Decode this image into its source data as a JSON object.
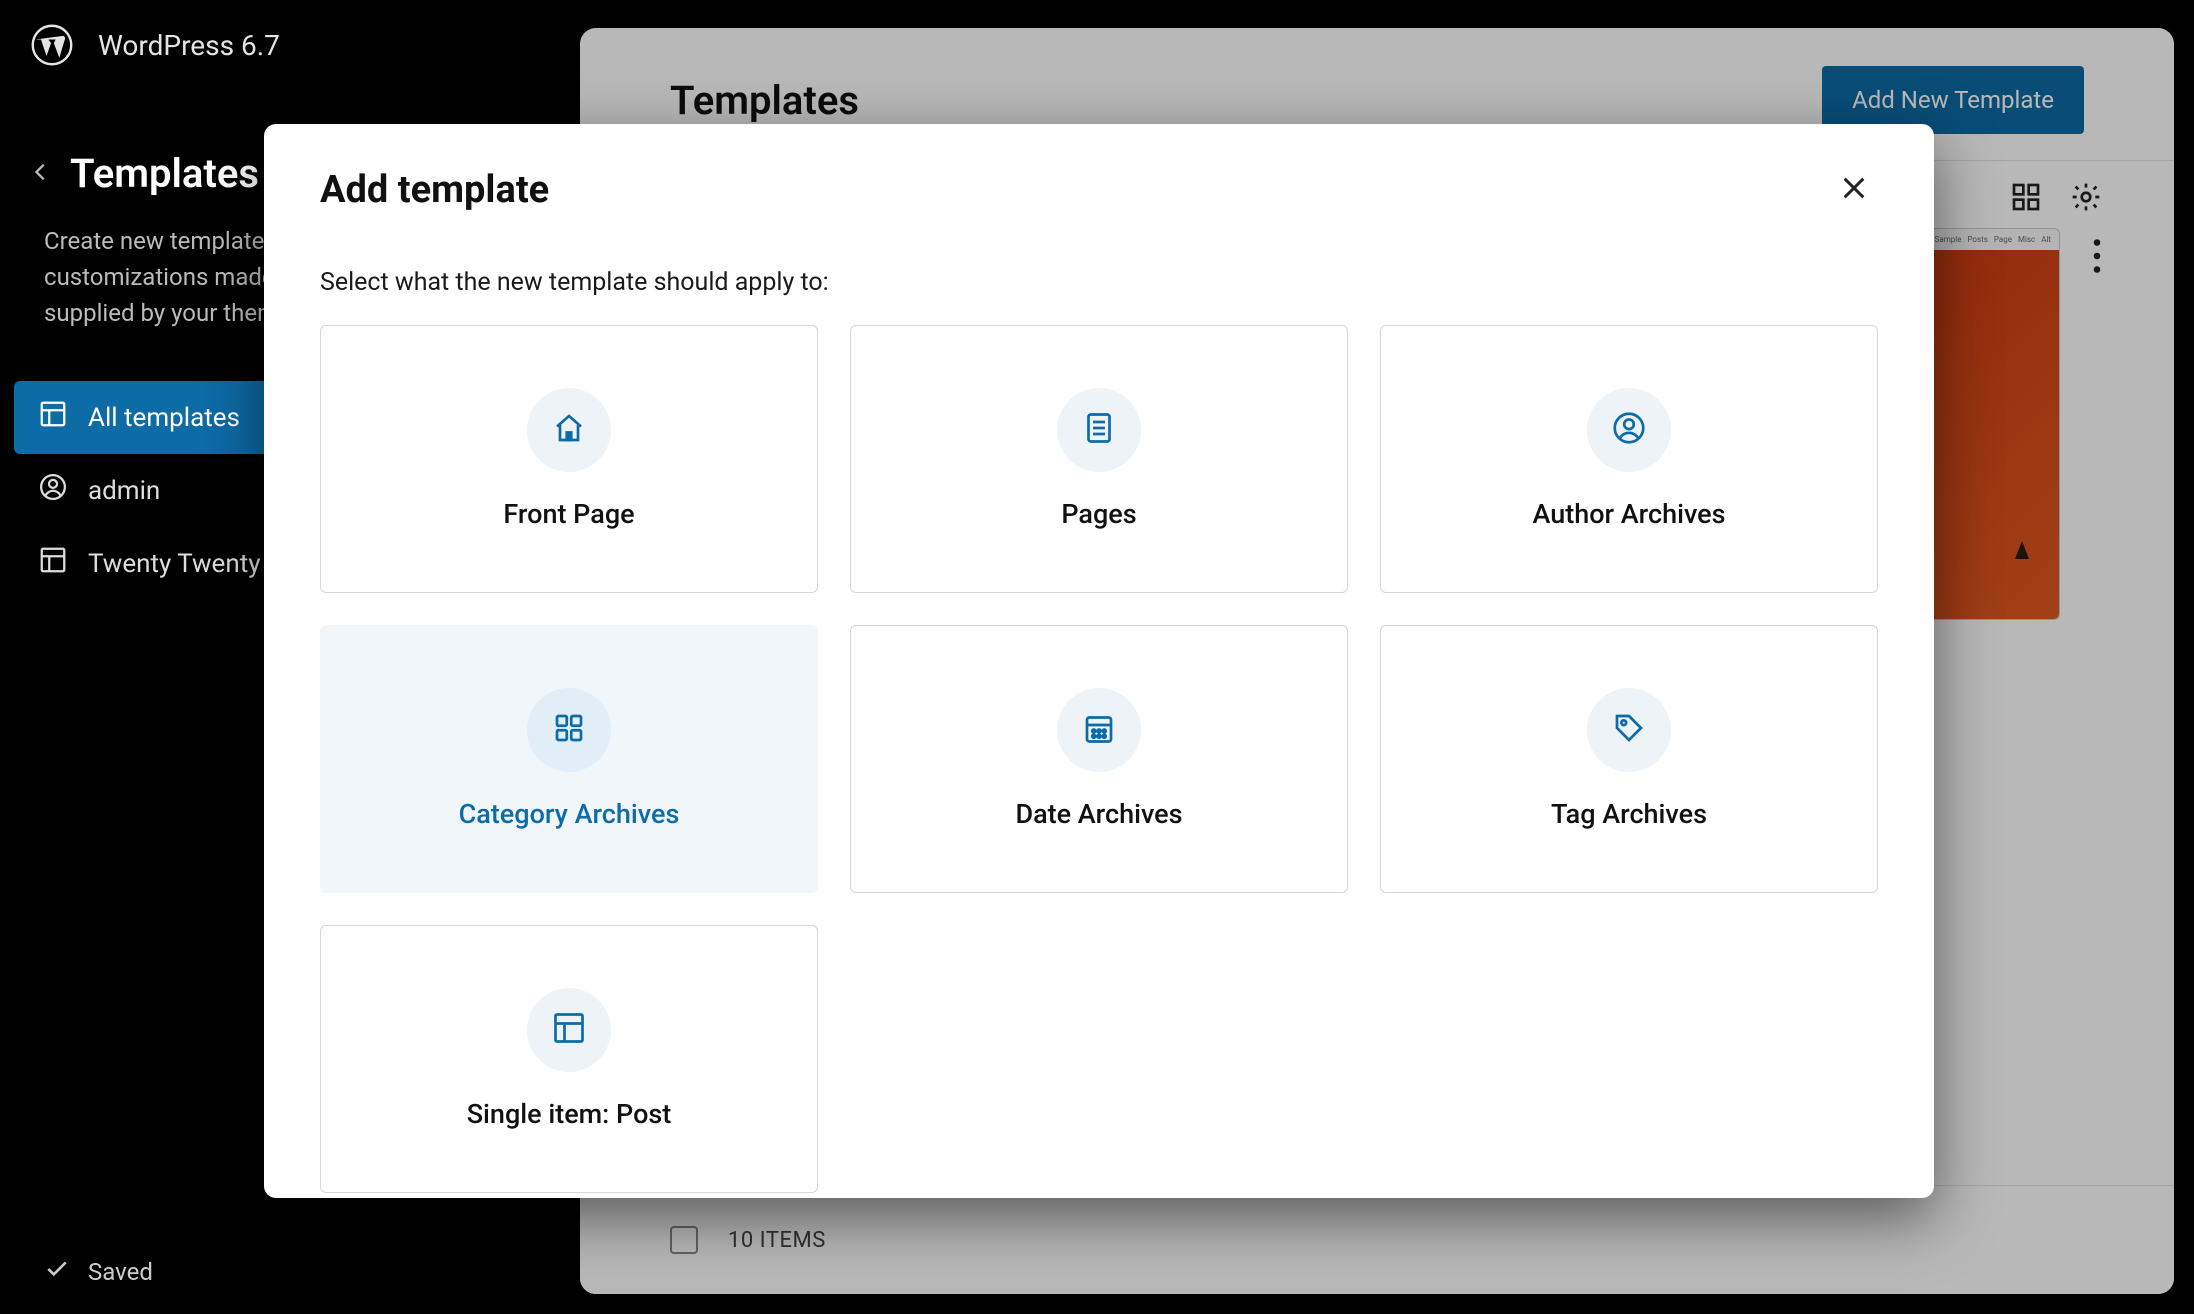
{
  "topbar": {
    "site_title": "WordPress 6.7"
  },
  "sidebar": {
    "title": "Templates",
    "description": "Create new templates, or reset any customizations made to the templates supplied by your theme.",
    "items": [
      {
        "label": "All templates",
        "active": true
      },
      {
        "label": "admin",
        "active": false
      },
      {
        "label": "Twenty Twenty",
        "active": false
      }
    ],
    "footer_status": "Saved"
  },
  "main": {
    "title": "Templates",
    "add_button": "Add New Template",
    "items_label": "10 ITEMS"
  },
  "modal": {
    "title": "Add template",
    "subtitle": "Select what the new template should apply to:",
    "options": [
      {
        "label": "Front Page",
        "icon": "home"
      },
      {
        "label": "Pages",
        "icon": "page"
      },
      {
        "label": "Author Archives",
        "icon": "person"
      },
      {
        "label": "Category Archives",
        "icon": "grid",
        "hover": true
      },
      {
        "label": "Date Archives",
        "icon": "calendar"
      },
      {
        "label": "Tag Archives",
        "icon": "tag"
      },
      {
        "label": "Single item: Post",
        "icon": "layout"
      }
    ]
  }
}
